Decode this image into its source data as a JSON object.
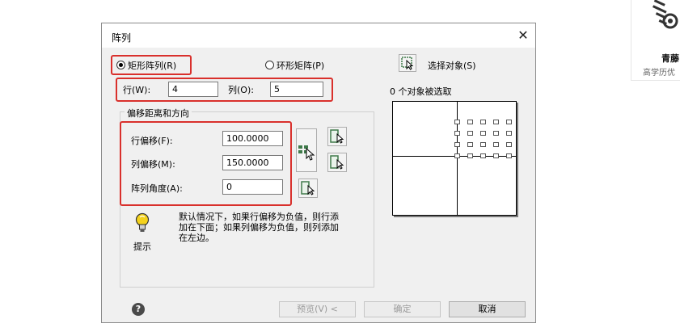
{
  "dialog": {
    "title": "阵列",
    "close_glyph": "✕",
    "rect_array_label": "矩形阵列(R)",
    "polar_array_label": "环形矩阵(P)",
    "select_objects_label": "选择对象(S)",
    "selected_count_text": "0 个对象被选取",
    "rows_label": "行(W):",
    "rows_value": "4",
    "cols_label": "列(O):",
    "cols_value": "5",
    "offset_group_label": "偏移距离和方向",
    "row_offset_label": "行偏移(F):",
    "row_offset_value": "100.0000",
    "col_offset_label": "列偏移(M):",
    "col_offset_value": "150.0000",
    "angle_label": "阵列角度(A):",
    "angle_value": "0",
    "tip_icon_label": "提示",
    "tip_text_line1": "默认情况下，如果行偏移为负值，则行添",
    "tip_text_line2": "加在下面；如果列偏移为负值，则列添加",
    "tip_text_line3": "在左边。",
    "help_glyph": "?",
    "preview_button": "预览(V) <",
    "ok_button": "确定",
    "cancel_button": "取消"
  },
  "watermark": {
    "brand_text": "青藤",
    "sub_text": "高学历优"
  },
  "colors": {
    "highlight": "#d9302c",
    "dialog_bg": "#f0f0f0"
  }
}
